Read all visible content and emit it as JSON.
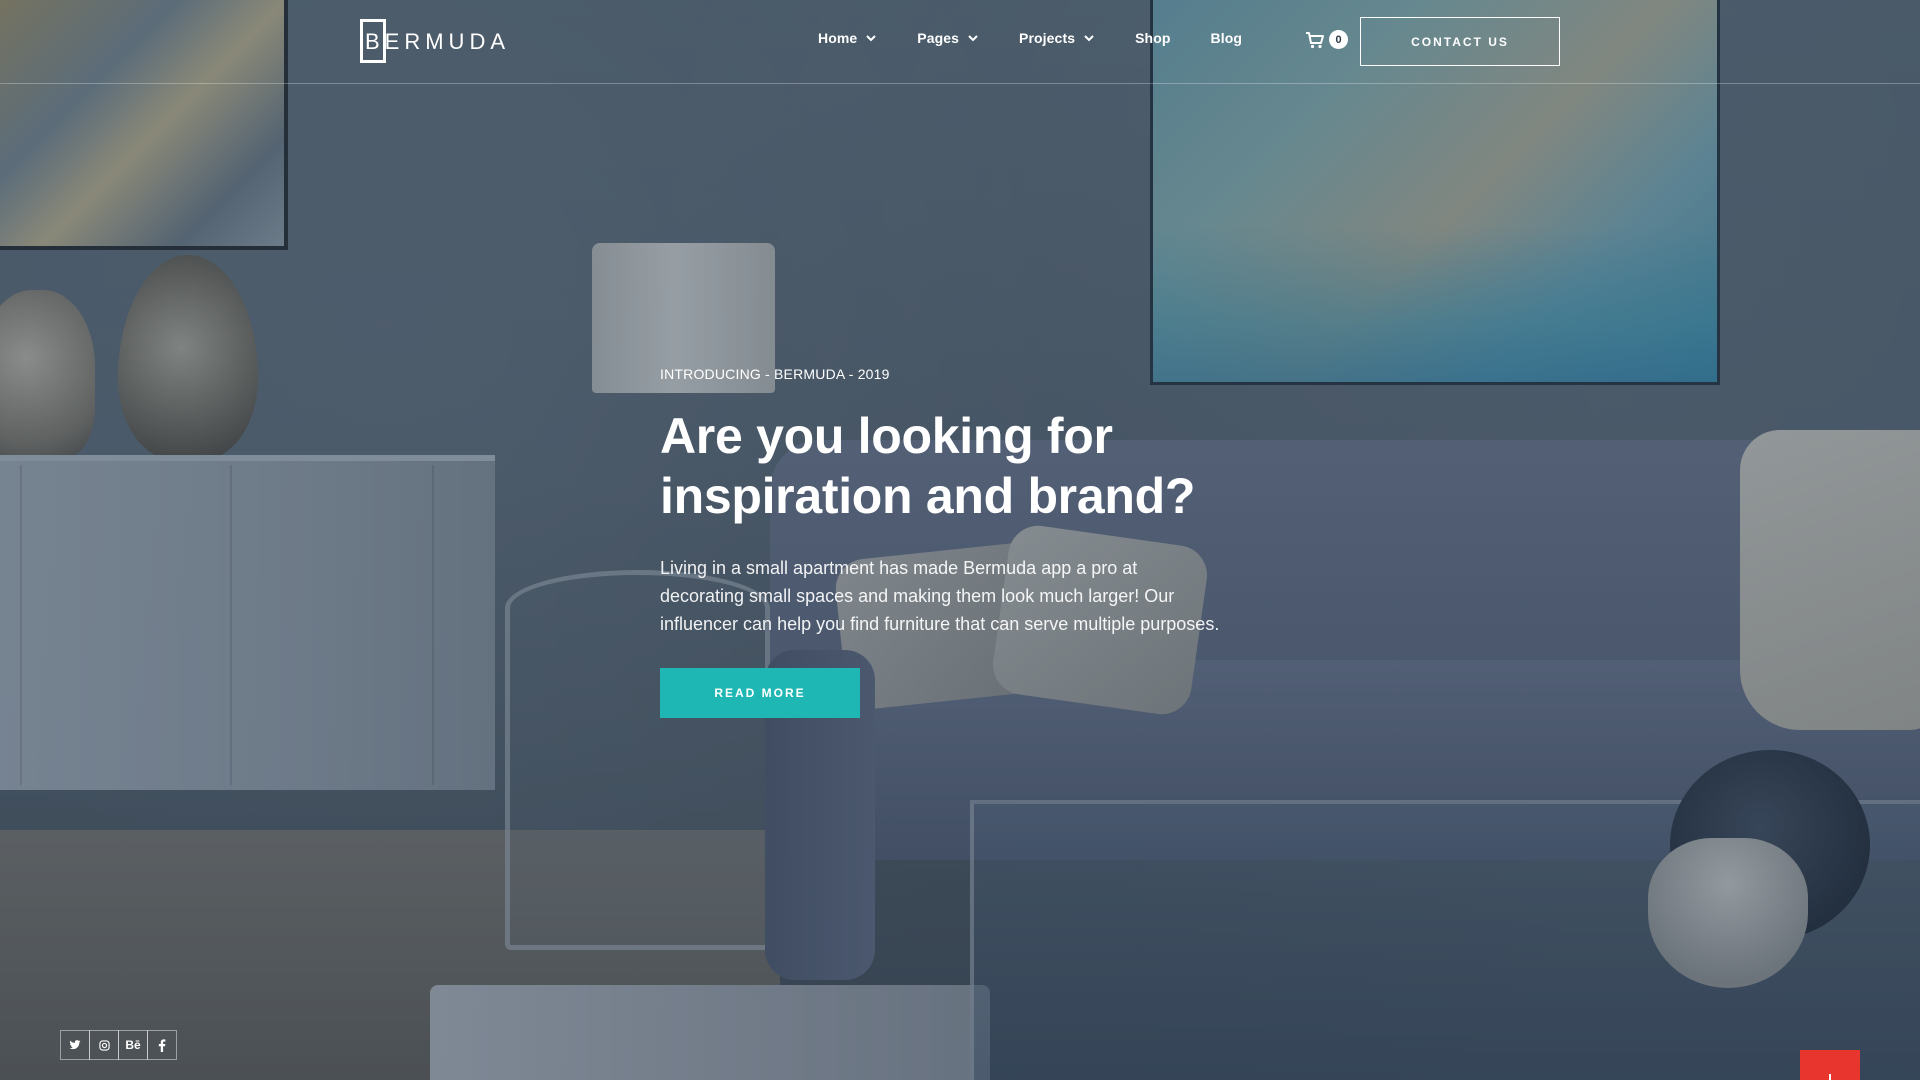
{
  "brand": {
    "logo_text": "BERMUDA",
    "accent_color": "#1fb7b3",
    "back_to_top_color": "#e8352d"
  },
  "nav": {
    "items": [
      {
        "label": "Home",
        "has_dropdown": true
      },
      {
        "label": "Pages",
        "has_dropdown": true
      },
      {
        "label": "Projects",
        "has_dropdown": true
      },
      {
        "label": "Shop",
        "has_dropdown": false
      },
      {
        "label": "Blog",
        "has_dropdown": false
      }
    ],
    "cart_count": "0",
    "contact_label": "CONTACT US"
  },
  "hero": {
    "eyebrow": "INTRODUCING - BERMUDA - 2019",
    "headline": "Are you looking for inspiration and brand?",
    "body": "Living in a small apartment has made Bermuda app a pro at decorating small spaces and making them look much larger! Our influencer can help you find furniture that can serve multiple purposes.",
    "cta_label": "READ MORE"
  },
  "social": [
    {
      "icon": "twitter-icon"
    },
    {
      "icon": "instagram-icon"
    },
    {
      "icon": "behance-icon",
      "label": "Bē"
    },
    {
      "icon": "facebook-icon"
    }
  ]
}
